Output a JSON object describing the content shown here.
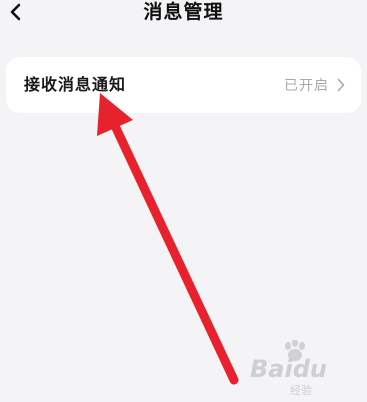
{
  "header": {
    "back_icon": "chevron-left-icon",
    "title": "消息管理"
  },
  "settings": {
    "items": [
      {
        "label": "接收消息通知",
        "status": "已开启",
        "chevron_icon": "chevron-right-icon"
      }
    ]
  },
  "annotation": {
    "arrow_color": "#e8222d"
  },
  "watermark": {
    "brand": "Baidu",
    "sub": "经验"
  }
}
